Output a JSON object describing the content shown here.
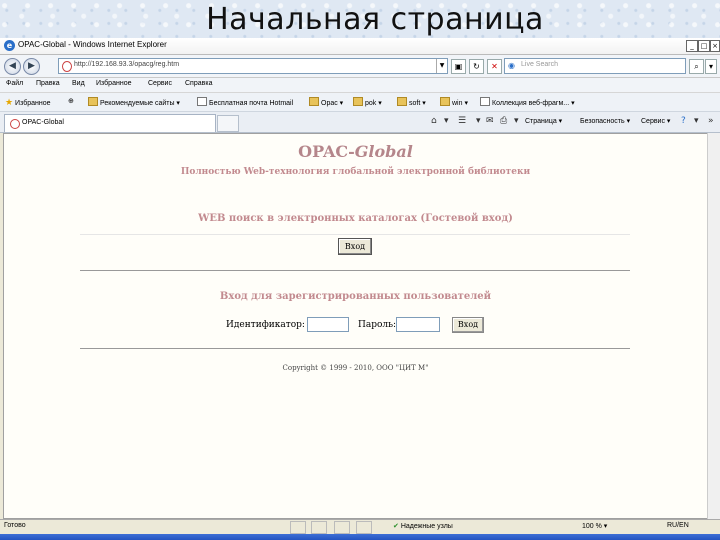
{
  "slide": {
    "title": "Начальная страница"
  },
  "window": {
    "title": "OPAC-Global - Windows Internet Explorer",
    "controls": {
      "minimize": "_",
      "maximize": "□",
      "close": "×"
    }
  },
  "address": {
    "url": "http://192.168.93.3/opacg/reg.htm",
    "search_placeholder": "Live Search"
  },
  "menu": [
    "Файл",
    "Правка",
    "Вид",
    "Избранное",
    "Сервис",
    "Справка"
  ],
  "favorites": {
    "label": "Избранное",
    "items": [
      {
        "label": "Рекомендуемые сайты",
        "icon": "folder-icon"
      },
      {
        "label": "Бесплатная почта Hotmail",
        "icon": "page-icon"
      },
      {
        "label": "Opac",
        "icon": "folder-icon"
      },
      {
        "label": "pok",
        "icon": "folder-icon"
      },
      {
        "label": "soft",
        "icon": "folder-icon"
      },
      {
        "label": "win",
        "icon": "folder-icon"
      },
      {
        "label": "Коллекция веб-фрагм...",
        "icon": "page-icon"
      }
    ]
  },
  "tab": {
    "label": "OPAC-Global"
  },
  "commands": {
    "page": "Страница",
    "safety": "Безопасность",
    "service": "Сервис"
  },
  "content": {
    "title_prefix": "OPAC-",
    "title_italic": "Global",
    "subtitle": "Полностью Web-технология глобальной электронной библиотеки",
    "web_search": "WEB поиск в электронных каталогах (Гостевой вход)",
    "enter_button": "Вход",
    "registered": "Вход для зарегистрированных пользователей",
    "id_label": "Идентификатор:",
    "password_label": "Пароль:",
    "id_value": "",
    "password_value": "",
    "login_button": "Вход",
    "copyright": "Copyright © 1999 - 2010, ООО \"ЦИТ М\""
  },
  "status": {
    "text": "Готово",
    "zone": "Надежные узлы",
    "zoom": "100 %",
    "lang": "RU/EN"
  },
  "colors": {
    "accent": "#c28a8f",
    "window": "#ece9d8",
    "page": "#fffef9"
  }
}
